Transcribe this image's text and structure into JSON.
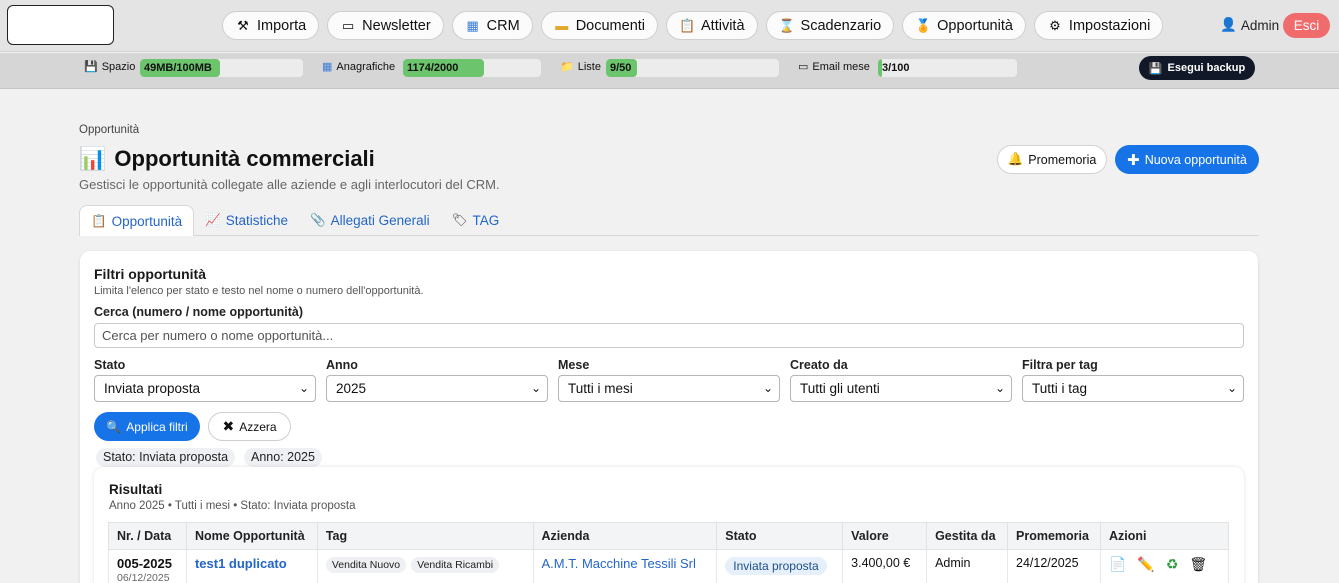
{
  "nav": {
    "items": [
      {
        "icon": "tools-icon",
        "glyph": "⚒",
        "label": "Importa"
      },
      {
        "icon": "newsletter-icon",
        "glyph": "▭",
        "label": "Newsletter"
      },
      {
        "icon": "crm-icon",
        "glyph": "▦",
        "label": "CRM"
      },
      {
        "icon": "folder-icon",
        "glyph": "▬",
        "label": "Documenti"
      },
      {
        "icon": "clipboard-icon",
        "glyph": "📋",
        "label": "Attività"
      },
      {
        "icon": "hourglass-icon",
        "glyph": "⌛",
        "label": "Scadenzario"
      },
      {
        "icon": "medal-icon",
        "glyph": "🏅",
        "label": "Opportunità"
      },
      {
        "icon": "gear-icon",
        "glyph": "⚙",
        "label": "Impostazioni"
      }
    ],
    "user": "Admin",
    "logout": "Esci"
  },
  "quota": {
    "items": [
      {
        "icon": "floppy-icon",
        "glyph": "💾",
        "label": "Spazio",
        "value": "49MB/100MB",
        "fraction": 0.49
      },
      {
        "icon": "grid-icon",
        "glyph": "▦",
        "label": "Anagrafiche",
        "value": "1174/2000",
        "fraction": 0.587
      },
      {
        "icon": "folder-icon",
        "glyph": "📁",
        "label": "Liste",
        "value": "9/50",
        "fraction": 0.18
      },
      {
        "icon": "mail-icon",
        "glyph": "▭",
        "label": "Email mese",
        "value": "3/100",
        "fraction": 0.03
      }
    ],
    "backup": "Esegui backup"
  },
  "page": {
    "breadcrumb": "Opportunità",
    "title": "Opportunità commerciali",
    "subtitle": "Gestisci le opportunità collegate alle aziende e agli interlocutori del CRM.",
    "reminder": "Promemoria",
    "new": "Nuova opportunità"
  },
  "tabs": [
    {
      "icon": "clipboard-icon",
      "glyph": "📋",
      "label": "Opportunità"
    },
    {
      "icon": "chart-icon",
      "glyph": "📈",
      "label": "Statistiche"
    },
    {
      "icon": "paperclip-icon",
      "glyph": "📎",
      "label": "Allegati Generali"
    },
    {
      "icon": "tag-icon",
      "glyph": "🏷",
      "label": "TAG"
    }
  ],
  "filters": {
    "title": "Filtri opportunità",
    "description": "Limita l'elenco per stato e testo nel nome o numero dell'opportunità.",
    "search_label": "Cerca (numero / nome opportunità)",
    "search_placeholder": "Cerca per numero o nome opportunità...",
    "selects": [
      {
        "label": "Stato",
        "value": "Inviata proposta"
      },
      {
        "label": "Anno",
        "value": "2025"
      },
      {
        "label": "Mese",
        "value": "Tutti i mesi"
      },
      {
        "label": "Creato da",
        "value": "Tutti gli utenti"
      },
      {
        "label": "Filtra per tag",
        "value": "Tutti i tag"
      }
    ],
    "apply": "Applica filtri",
    "reset": "Azzera",
    "chips": [
      "Stato: Inviata proposta",
      "Anno: 2025"
    ]
  },
  "results": {
    "title": "Risultati",
    "description": "Anno 2025 • Tutti i mesi • Stato: Inviata proposta",
    "columns": [
      "Nr. / Data",
      "Nome Opportunità",
      "Tag",
      "Azienda",
      "Stato",
      "Valore",
      "Gestita da",
      "Promemoria",
      "Azioni"
    ],
    "rows": [
      {
        "nr": "005-2025",
        "date": "06/12/2025",
        "name": "test1 duplicato",
        "tags": [
          "Vendita Nuovo",
          "Vendita Ricambi"
        ],
        "company": "A.M.T. Macchine Tessili Srl",
        "status": "Inviata proposta",
        "value": "3.400,00 €",
        "managed_by": "Admin",
        "reminder": "24/12/2025"
      }
    ]
  }
}
